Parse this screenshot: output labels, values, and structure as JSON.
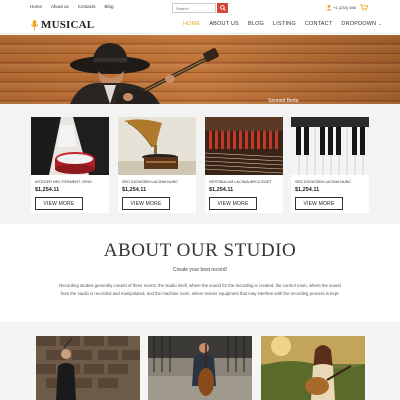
{
  "topbar": {
    "links": [
      "Home",
      "About us",
      "Contacts",
      "Blog"
    ],
    "search_placeholder": "Search",
    "phone": "+1 (234) 456"
  },
  "navbar": {
    "logo_text": "MUSICAL",
    "menu": [
      "HOME",
      "ABOUT US",
      "BLOG",
      "LISTING",
      "CONTACT",
      "DROPDOWN"
    ],
    "active_menu": "HOME"
  },
  "hero": {
    "caption": "Sennett Berta"
  },
  "products": [
    {
      "name": "INTEGER NEC FERMENT. ORIO",
      "price": "$1,254.11",
      "button": "VIEW MORE"
    },
    {
      "name": "SED DICNISSIM LACINIA NUNC",
      "price": "$1,254.11",
      "button": "VIEW MORE"
    },
    {
      "name": "VESTIBULUM LACINIA ARCU EGET",
      "price": "$1,254.11",
      "button": "VIEW MORE"
    },
    {
      "name": "SED DICNISSIM LACINIA NUNC",
      "price": "$1,254.11",
      "button": "VIEW MORE"
    }
  ],
  "about": {
    "title": "ABOUT OUR STUDIO",
    "subtitle": "Create your best record!",
    "body": "Recording studios generally consist of three rooms: the studio itself, where the sound for the recording is created, the control room, where the sound from the studio is recorded and manipulated, and the machine room, where noisier equipment that may interfere with the recording process is kept."
  },
  "colors": {
    "accent": "#f0a61c",
    "search_button": "#d9443a"
  }
}
